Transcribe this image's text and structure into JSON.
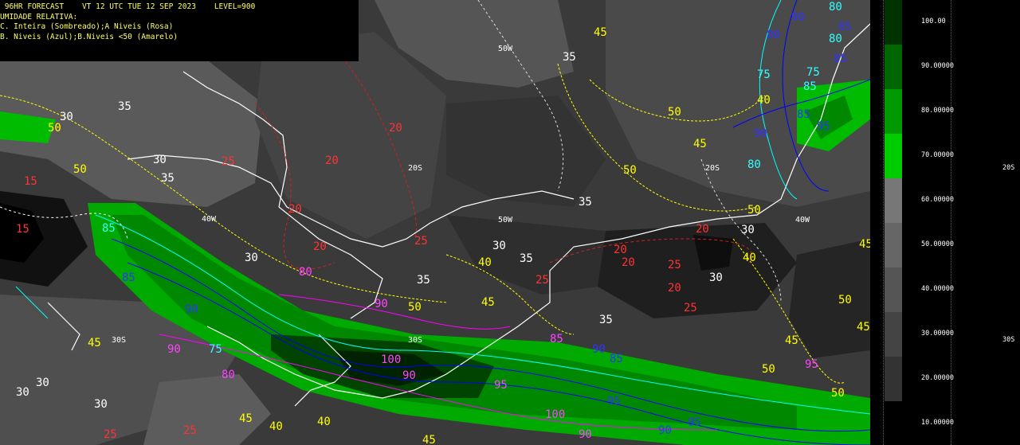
{
  "header": {
    "line1": " 96HR FORECAST    VT 12 UTC TUE 12 SEP 2023    LEVEL=900",
    "line2": "UMIDADE RELATIVA:",
    "line3": "C. Inteira (Sombreado);A Niveis (Rosa)",
    "line4": "B. Niveis (Azul);B.Niveis <50 (Amarelo)"
  },
  "colorbar": {
    "labels": [
      "100.00",
      "90.00000",
      "80.00000",
      "70.00000",
      "60.00000",
      "50.00000",
      "40.00000",
      "30.00000",
      "20.00000",
      "10.00000"
    ],
    "colors": [
      "#003300",
      "#006600",
      "#009900",
      "#00cc00",
      "#777777",
      "#666666",
      "#555555",
      "#444444",
      "#333333",
      "#000000"
    ]
  },
  "right_labels": [
    "20S",
    "30S"
  ],
  "grid_labels": [
    "50W",
    "40W",
    "20S",
    "30S",
    "40W",
    "50W",
    "20S",
    "30S"
  ],
  "contours": {
    "yellow": [
      "45",
      "50",
      "40",
      "45",
      "50",
      "50",
      "40",
      "45",
      "50",
      "40",
      "45",
      "50",
      "45",
      "50",
      "45",
      "50",
      "40",
      "45",
      "50",
      "45",
      "50",
      "40",
      "45"
    ],
    "white": [
      "35",
      "30",
      "30",
      "35",
      "30",
      "35",
      "30",
      "30",
      "35",
      "35",
      "30",
      "35",
      "30",
      "30",
      "30",
      "35"
    ],
    "red": [
      "20",
      "25",
      "20",
      "20",
      "20",
      "25",
      "25",
      "20",
      "20",
      "25",
      "20",
      "20",
      "25",
      "15",
      "15",
      "25",
      "25"
    ],
    "blue": [
      "90",
      "85",
      "80",
      "85",
      "90",
      "95",
      "85",
      "90",
      "85",
      "95",
      "90",
      "95",
      "90",
      "85"
    ],
    "cyan": [
      "80",
      "75",
      "80",
      "85",
      "75",
      "80",
      "85",
      "75"
    ],
    "magenta": [
      "80",
      "90",
      "100",
      "90",
      "95",
      "85",
      "100",
      "90",
      "80",
      "95",
      "90"
    ]
  },
  "colors": {
    "bg_dark": "#2a2a2a",
    "green_mid": "#00cc00",
    "green_dark": "#003300",
    "header_text": "#ffff66"
  }
}
